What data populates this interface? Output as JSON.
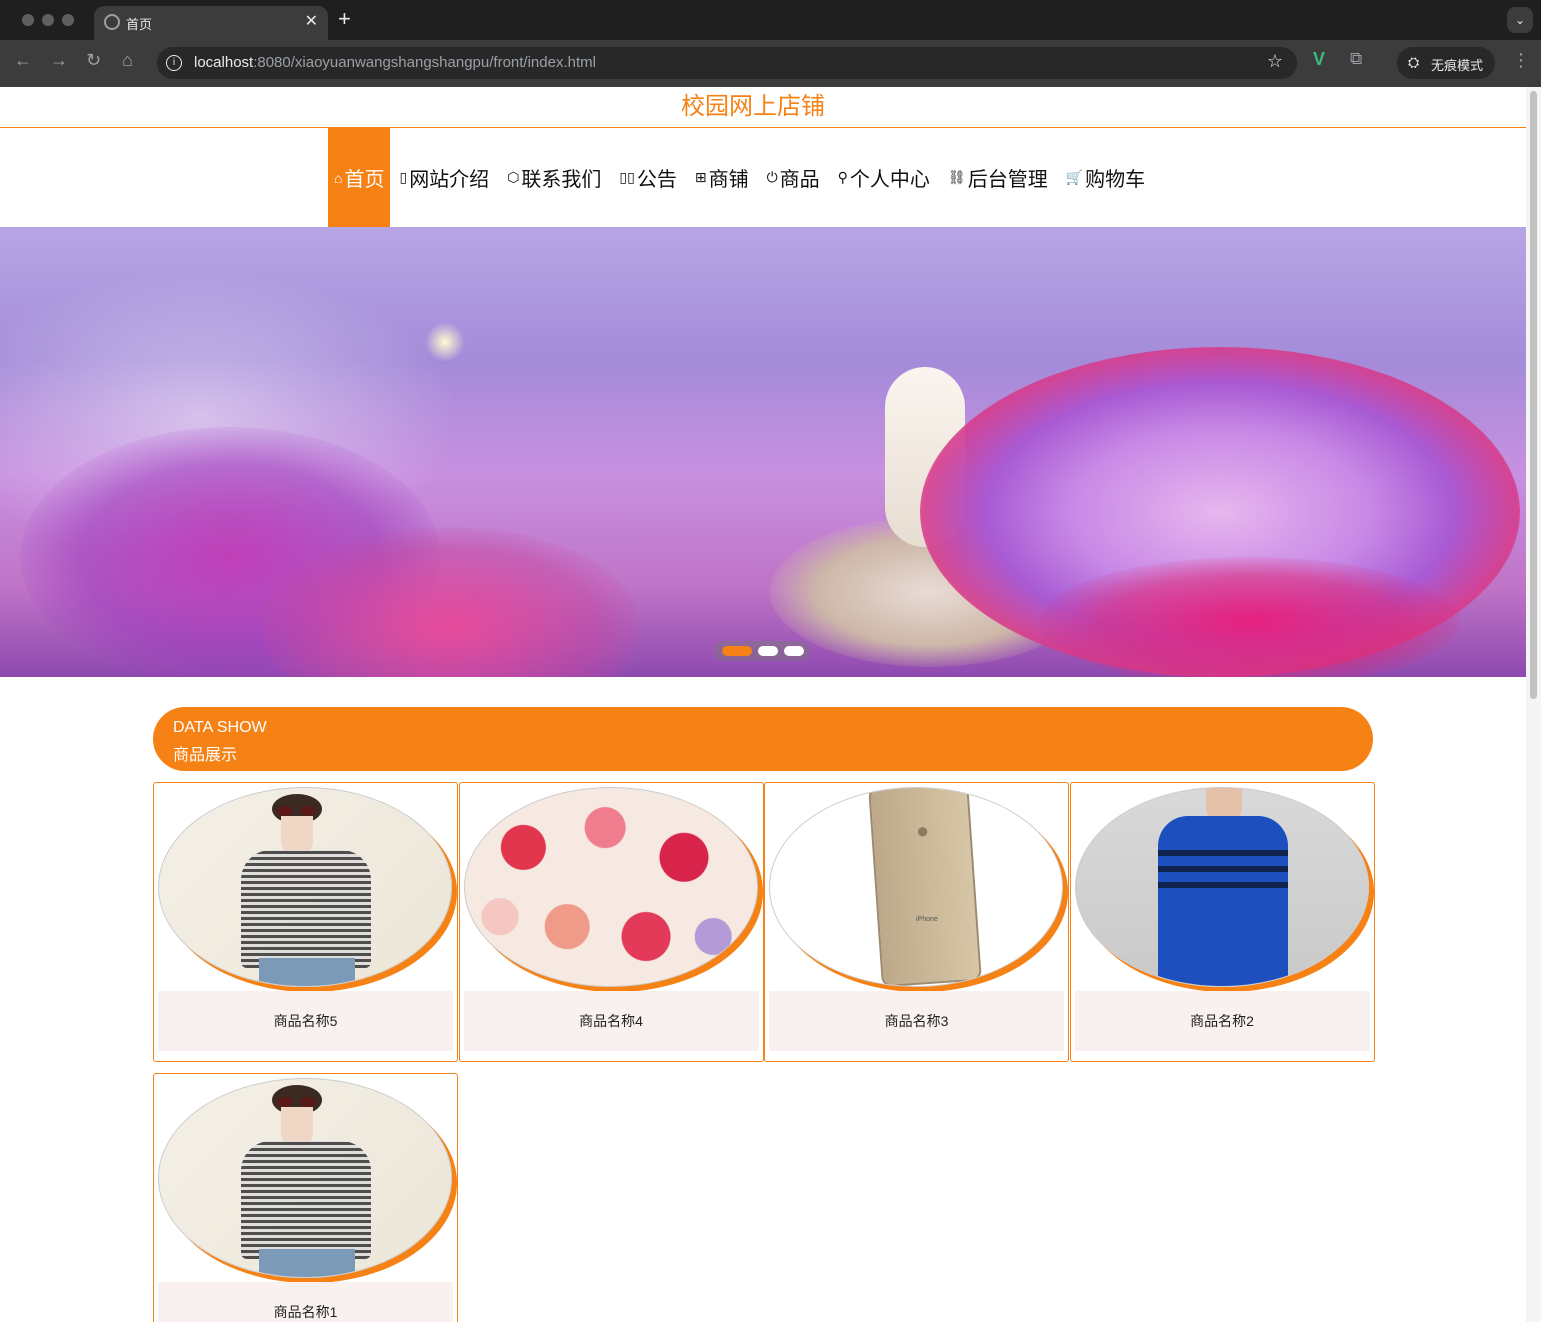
{
  "browser": {
    "tab_title": "首页",
    "tab_close": "✕",
    "new_tab": "+",
    "url_host": "localhost",
    "url_rest": ":8080/xiaoyuanwangshangshangpu/front/index.html",
    "incognito_label": "无痕模式"
  },
  "site": {
    "title": "校园网上店铺"
  },
  "nav": [
    {
      "icon": "⌂",
      "label": "首页",
      "active": true
    },
    {
      "icon": "▯",
      "label": "网站介绍"
    },
    {
      "icon": "⬡",
      "label": "联系我们"
    },
    {
      "icon": "▯▯",
      "label": "公告"
    },
    {
      "icon": "⊞",
      "label": "商铺"
    },
    {
      "icon": "⏻",
      "label": "商品"
    },
    {
      "icon": "⚲",
      "label": "个人中心"
    },
    {
      "icon": "⛓",
      "label": "后台管理"
    },
    {
      "icon": "🛒",
      "label": "购物车"
    }
  ],
  "banner": {
    "slide_count": 3,
    "active_slide": 1
  },
  "data_show": {
    "title_en": "DATA SHOW",
    "title_cn": "商品展示",
    "products": [
      {
        "name": "商品名称5",
        "image": "checkered-blouse"
      },
      {
        "name": "商品名称4",
        "image": "rose-bouquet"
      },
      {
        "name": "商品名称3",
        "image": "iphone"
      },
      {
        "name": "商品名称2",
        "image": "blue-sweater"
      },
      {
        "name": "商品名称1",
        "image": "checkered-blouse"
      }
    ]
  },
  "colors": {
    "accent": "#f68114",
    "label_bg": "#f8f1f0"
  }
}
